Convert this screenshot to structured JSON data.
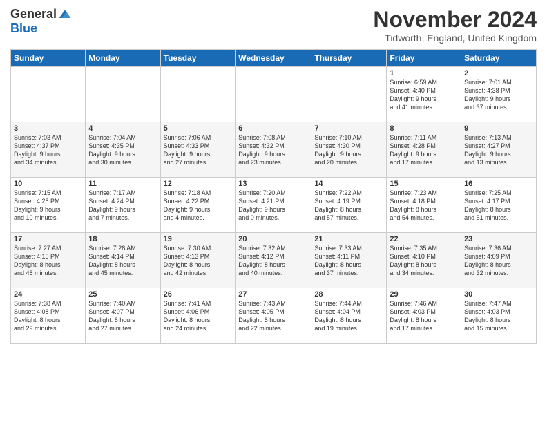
{
  "logo": {
    "general": "General",
    "blue": "Blue"
  },
  "title": "November 2024",
  "location": "Tidworth, England, United Kingdom",
  "headers": [
    "Sunday",
    "Monday",
    "Tuesday",
    "Wednesday",
    "Thursday",
    "Friday",
    "Saturday"
  ],
  "weeks": [
    [
      {
        "day": "",
        "info": ""
      },
      {
        "day": "",
        "info": ""
      },
      {
        "day": "",
        "info": ""
      },
      {
        "day": "",
        "info": ""
      },
      {
        "day": "",
        "info": ""
      },
      {
        "day": "1",
        "info": "Sunrise: 6:59 AM\nSunset: 4:40 PM\nDaylight: 9 hours\nand 41 minutes."
      },
      {
        "day": "2",
        "info": "Sunrise: 7:01 AM\nSunset: 4:38 PM\nDaylight: 9 hours\nand 37 minutes."
      }
    ],
    [
      {
        "day": "3",
        "info": "Sunrise: 7:03 AM\nSunset: 4:37 PM\nDaylight: 9 hours\nand 34 minutes."
      },
      {
        "day": "4",
        "info": "Sunrise: 7:04 AM\nSunset: 4:35 PM\nDaylight: 9 hours\nand 30 minutes."
      },
      {
        "day": "5",
        "info": "Sunrise: 7:06 AM\nSunset: 4:33 PM\nDaylight: 9 hours\nand 27 minutes."
      },
      {
        "day": "6",
        "info": "Sunrise: 7:08 AM\nSunset: 4:32 PM\nDaylight: 9 hours\nand 23 minutes."
      },
      {
        "day": "7",
        "info": "Sunrise: 7:10 AM\nSunset: 4:30 PM\nDaylight: 9 hours\nand 20 minutes."
      },
      {
        "day": "8",
        "info": "Sunrise: 7:11 AM\nSunset: 4:28 PM\nDaylight: 9 hours\nand 17 minutes."
      },
      {
        "day": "9",
        "info": "Sunrise: 7:13 AM\nSunset: 4:27 PM\nDaylight: 9 hours\nand 13 minutes."
      }
    ],
    [
      {
        "day": "10",
        "info": "Sunrise: 7:15 AM\nSunset: 4:25 PM\nDaylight: 9 hours\nand 10 minutes."
      },
      {
        "day": "11",
        "info": "Sunrise: 7:17 AM\nSunset: 4:24 PM\nDaylight: 9 hours\nand 7 minutes."
      },
      {
        "day": "12",
        "info": "Sunrise: 7:18 AM\nSunset: 4:22 PM\nDaylight: 9 hours\nand 4 minutes."
      },
      {
        "day": "13",
        "info": "Sunrise: 7:20 AM\nSunset: 4:21 PM\nDaylight: 9 hours\nand 0 minutes."
      },
      {
        "day": "14",
        "info": "Sunrise: 7:22 AM\nSunset: 4:19 PM\nDaylight: 8 hours\nand 57 minutes."
      },
      {
        "day": "15",
        "info": "Sunrise: 7:23 AM\nSunset: 4:18 PM\nDaylight: 8 hours\nand 54 minutes."
      },
      {
        "day": "16",
        "info": "Sunrise: 7:25 AM\nSunset: 4:17 PM\nDaylight: 8 hours\nand 51 minutes."
      }
    ],
    [
      {
        "day": "17",
        "info": "Sunrise: 7:27 AM\nSunset: 4:15 PM\nDaylight: 8 hours\nand 48 minutes."
      },
      {
        "day": "18",
        "info": "Sunrise: 7:28 AM\nSunset: 4:14 PM\nDaylight: 8 hours\nand 45 minutes."
      },
      {
        "day": "19",
        "info": "Sunrise: 7:30 AM\nSunset: 4:13 PM\nDaylight: 8 hours\nand 42 minutes."
      },
      {
        "day": "20",
        "info": "Sunrise: 7:32 AM\nSunset: 4:12 PM\nDaylight: 8 hours\nand 40 minutes."
      },
      {
        "day": "21",
        "info": "Sunrise: 7:33 AM\nSunset: 4:11 PM\nDaylight: 8 hours\nand 37 minutes."
      },
      {
        "day": "22",
        "info": "Sunrise: 7:35 AM\nSunset: 4:10 PM\nDaylight: 8 hours\nand 34 minutes."
      },
      {
        "day": "23",
        "info": "Sunrise: 7:36 AM\nSunset: 4:09 PM\nDaylight: 8 hours\nand 32 minutes."
      }
    ],
    [
      {
        "day": "24",
        "info": "Sunrise: 7:38 AM\nSunset: 4:08 PM\nDaylight: 8 hours\nand 29 minutes."
      },
      {
        "day": "25",
        "info": "Sunrise: 7:40 AM\nSunset: 4:07 PM\nDaylight: 8 hours\nand 27 minutes."
      },
      {
        "day": "26",
        "info": "Sunrise: 7:41 AM\nSunset: 4:06 PM\nDaylight: 8 hours\nand 24 minutes."
      },
      {
        "day": "27",
        "info": "Sunrise: 7:43 AM\nSunset: 4:05 PM\nDaylight: 8 hours\nand 22 minutes."
      },
      {
        "day": "28",
        "info": "Sunrise: 7:44 AM\nSunset: 4:04 PM\nDaylight: 8 hours\nand 19 minutes."
      },
      {
        "day": "29",
        "info": "Sunrise: 7:46 AM\nSunset: 4:03 PM\nDaylight: 8 hours\nand 17 minutes."
      },
      {
        "day": "30",
        "info": "Sunrise: 7:47 AM\nSunset: 4:03 PM\nDaylight: 8 hours\nand 15 minutes."
      }
    ]
  ]
}
